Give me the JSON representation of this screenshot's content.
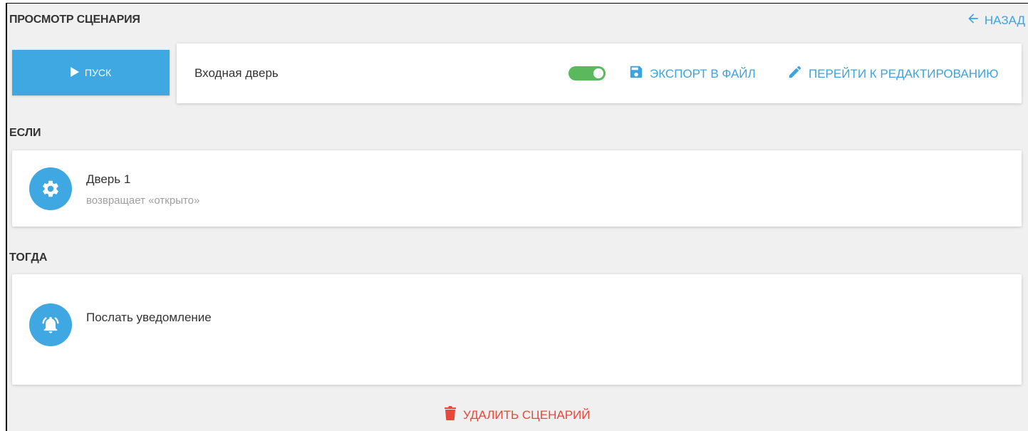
{
  "page": {
    "title": "ПРОСМОТР СЦЕНАРИЯ",
    "back_label": "НАЗАД",
    "back_icon": "arrow-left-icon"
  },
  "run_button": {
    "label": "ПУСК",
    "icon": "play-icon"
  },
  "header": {
    "scenario_name": "Входная дверь",
    "enabled": true,
    "export_label": "ЭКСПОРТ В ФАЙЛ",
    "export_icon": "floppy-disk-icon",
    "edit_label": "ПЕРЕЙТИ К РЕДАКТИРОВАНИЮ",
    "edit_icon": "pencil-icon"
  },
  "if_section": {
    "label": "ЕСЛИ",
    "items": [
      {
        "title": "Дверь 1",
        "subtitle": "возвращает «открыто»",
        "icon": "gear-icon"
      }
    ]
  },
  "then_section": {
    "label": "ТОГДА",
    "items": [
      {
        "title": "Послать уведомление",
        "icon": "bell-icon"
      }
    ]
  },
  "delete": {
    "label": "УДАЛИТЬ СЦЕНАРИЙ",
    "icon": "trash-icon"
  },
  "colors": {
    "accent": "#3fa7e1",
    "toggle_on": "#5cb85c",
    "danger": "#e8483b",
    "background": "#f0f0f0"
  }
}
